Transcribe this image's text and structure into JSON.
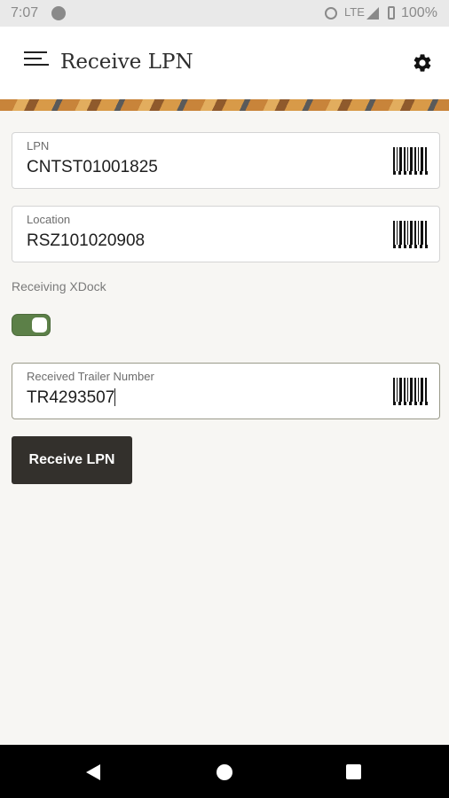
{
  "status_bar": {
    "time": "7:07",
    "network": "LTE",
    "battery": "100%",
    "icons": [
      "data-saver-icon",
      "alarm-icon",
      "signal-icon",
      "battery-icon"
    ]
  },
  "app_bar": {
    "title": "Receive LPN",
    "icons": [
      "menu-icon",
      "gear-icon"
    ]
  },
  "form": {
    "lpn": {
      "label": "LPN",
      "value": "CNTST01001825"
    },
    "location": {
      "label": "Location",
      "value": "RSZ101020908"
    },
    "xdock": {
      "label": "Receiving XDock",
      "enabled": true
    },
    "trailer": {
      "label": "Received Trailer Number",
      "value": "TR4293507"
    },
    "submit_label": "Receive LPN"
  },
  "nav_bar": {
    "icons": [
      "back-icon",
      "home-icon",
      "recents-icon"
    ]
  },
  "colors": {
    "toggle_on": "#5c8048",
    "button_bg": "#33302c",
    "app_bar_bg": "#ffffff",
    "page_bg": "#f7f6f3"
  }
}
